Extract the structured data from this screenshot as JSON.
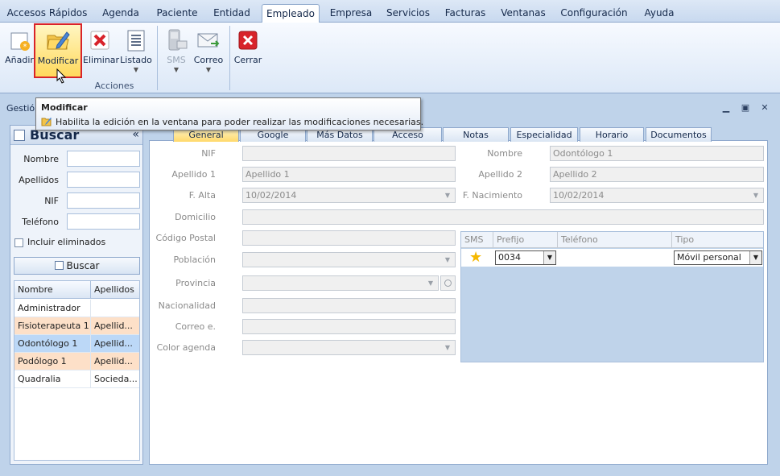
{
  "menu": {
    "tabs": [
      "Accesos Rápidos",
      "Agenda",
      "Paciente",
      "Entidad",
      "Empleado",
      "Empresa",
      "Servicios",
      "Facturas",
      "Ventanas",
      "Configuración",
      "Ayuda"
    ],
    "active": "Empleado"
  },
  "ribbon": {
    "buttons": {
      "add": "Añadir",
      "edit": "Modificar",
      "delete": "Eliminar",
      "list": "Listado",
      "sms": "SMS",
      "mail": "Correo",
      "close": "Cerrar"
    },
    "group_label": "Acciones"
  },
  "tooltip": {
    "title": "Modificar",
    "description": "Habilita la edición en la ventana para poder realizar las modificaciones necesarias."
  },
  "window": {
    "title": "Gestió"
  },
  "search_panel": {
    "title": "Buscar",
    "collapse": "«",
    "fields": {
      "name": "Nombre",
      "surnames": "Apellidos",
      "nif": "NIF",
      "phone": "Teléfono"
    },
    "include_deleted": "Incluir eliminados",
    "search_button": "Buscar",
    "columns": [
      "Nombre",
      "Apellidos"
    ],
    "rows": [
      {
        "name": "Administrador",
        "surname": "",
        "color": "#ffffff"
      },
      {
        "name": "Fisioterapeuta 1",
        "surname": "Apellid...",
        "color": "#fde0c8"
      },
      {
        "name": "Odontólogo 1",
        "surname": "Apellid...",
        "color": "#bcd8f7"
      },
      {
        "name": "Podólogo 1",
        "surname": "Apellid...",
        "color": "#fde0c8"
      },
      {
        "name": "Quadralia",
        "surname": "Socieda...",
        "color": "#ffffff"
      }
    ]
  },
  "form_tabs": [
    "General",
    "Google",
    "Más Datos",
    "Acceso",
    "Notas",
    "Especialidad",
    "Horario",
    "Documentos"
  ],
  "form": {
    "nif_label": "NIF",
    "name_label": "Nombre",
    "name_value": "Odontólogo 1",
    "surname1_label": "Apellido 1",
    "surname1_value": "Apellido 1",
    "surname2_label": "Apellido 2",
    "surname2_value": "Apellido 2",
    "hire_date_label": "F. Alta",
    "hire_date_value": "10/02/2014",
    "birth_date_label": "F. Nacimiento",
    "birth_date_value": "10/02/2014",
    "address_label": "Domicilio",
    "postal_code_label": "Código Postal",
    "town_label": "Población",
    "province_label": "Provincia",
    "nationality_label": "Nacionalidad",
    "email_label": "Correo e.",
    "agenda_color_label": "Color agenda"
  },
  "phones": {
    "columns": [
      "SMS",
      "Prefijo",
      "Teléfono",
      "Tipo"
    ],
    "row": {
      "prefix": "0034",
      "phone": "",
      "type": "Móvil personal"
    }
  }
}
